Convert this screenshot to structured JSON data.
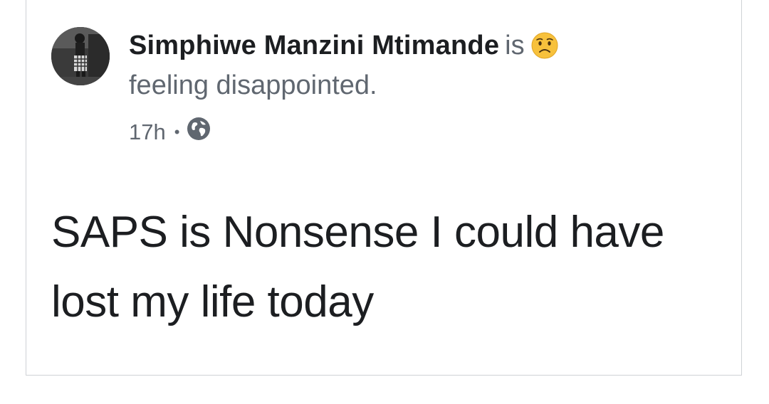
{
  "post": {
    "author": "Simphiwe Manzini Mtimande",
    "is_word": "is",
    "feeling_emoji": "disappointed-face-icon",
    "feeling_text": "feeling disappointed.",
    "timestamp": "17h",
    "separator": "•",
    "audience_icon": "globe-icon",
    "body_text": "SAPS is Nonsense I could have lost my life today"
  },
  "colors": {
    "author": "#1c1e21",
    "secondary": "#606770",
    "border": "#cfd2d6",
    "emoji_face": "#f7c13c"
  }
}
